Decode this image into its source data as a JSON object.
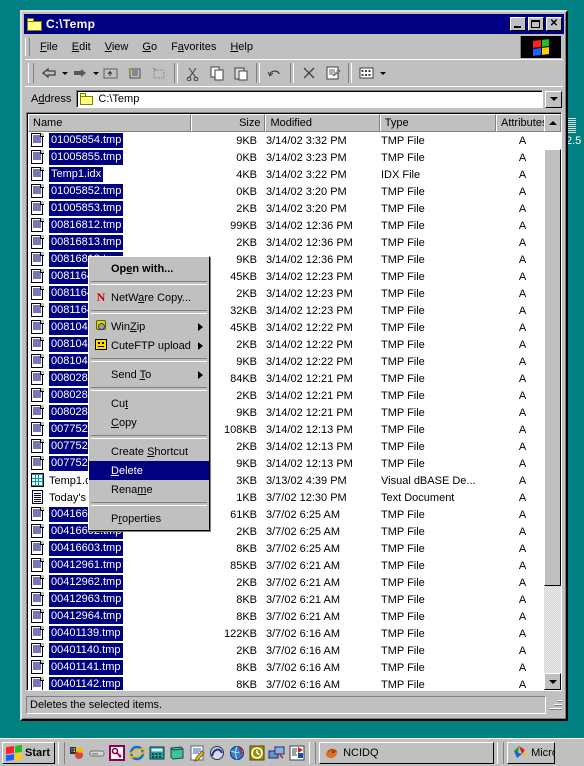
{
  "window": {
    "title": "C:\\Temp",
    "title_icon": "folder-icon",
    "buttons": {
      "minimize": "_",
      "maximize": "□",
      "close": "✕"
    }
  },
  "menubar": {
    "items": [
      {
        "label": "File",
        "accel": "F"
      },
      {
        "label": "Edit",
        "accel": "E"
      },
      {
        "label": "View",
        "accel": "V"
      },
      {
        "label": "Go",
        "accel": "G"
      },
      {
        "label": "Favorites",
        "accel": "a"
      },
      {
        "label": "Help",
        "accel": "H"
      }
    ]
  },
  "toolbar": {
    "buttons": [
      {
        "name": "back-button",
        "icon": "left-arrow-icon",
        "glyph": "⇦",
        "dropdown": true
      },
      {
        "name": "forward-button",
        "icon": "right-arrow-icon",
        "glyph": "⇨",
        "dropdown": true
      },
      {
        "name": "up-button",
        "icon": "up-folder-icon",
        "glyph": "⬆",
        "dropdown": false
      },
      {
        "name": "map-drive-button",
        "icon": "map-network-drive-icon",
        "glyph": "☷",
        "dropdown": false
      },
      {
        "name": "disconnect-drive-button",
        "icon": "disconnect-network-drive-icon",
        "glyph": "☰",
        "dropdown": false
      },
      {
        "name": "cut-button",
        "icon": "scissors-icon",
        "glyph": "✂",
        "dropdown": false
      },
      {
        "name": "copy-button",
        "icon": "copy-icon",
        "glyph": "⧉",
        "dropdown": false
      },
      {
        "name": "paste-button",
        "icon": "paste-icon",
        "glyph": "Ὄb",
        "dropdown": false
      },
      {
        "name": "undo-button",
        "icon": "undo-arrow-icon",
        "glyph": "↶",
        "dropdown": false
      },
      {
        "name": "delete-button",
        "icon": "x-icon",
        "glyph": "✕",
        "dropdown": false
      },
      {
        "name": "properties-button",
        "icon": "properties-icon",
        "glyph": "☑",
        "dropdown": false
      },
      {
        "name": "views-button",
        "icon": "views-icon",
        "glyph": "▦",
        "dropdown": true
      }
    ]
  },
  "address": {
    "label": "Address",
    "value": "C:\\Temp",
    "icon": "folder-icon",
    "dropdown_icon": "chevron-down-icon"
  },
  "columns": [
    {
      "key": "name",
      "label": "Name",
      "align": "left"
    },
    {
      "key": "size",
      "label": "Size",
      "align": "right"
    },
    {
      "key": "modified",
      "label": "Modified",
      "align": "left"
    },
    {
      "key": "type",
      "label": "Type",
      "align": "left"
    },
    {
      "key": "attributes",
      "label": "Attributes",
      "align": "left"
    }
  ],
  "files": [
    {
      "name": "01005854.tmp",
      "size": "9KB",
      "modified": "3/14/02 3:32 PM",
      "type": "TMP File",
      "attributes": "A",
      "icon": "tmp-file-icon",
      "selected": true,
      "focused": false
    },
    {
      "name": "01005855.tmp",
      "size": "0KB",
      "modified": "3/14/02 3:23 PM",
      "type": "TMP File",
      "attributes": "A",
      "icon": "tmp-file-icon",
      "selected": true,
      "focused": false
    },
    {
      "name": "Temp1.idx",
      "size": "4KB",
      "modified": "3/14/02 3:22 PM",
      "type": "IDX File",
      "attributes": "A",
      "icon": "tmp-file-icon",
      "selected": true,
      "focused": false
    },
    {
      "name": "01005852.tmp",
      "size": "0KB",
      "modified": "3/14/02 3:20 PM",
      "type": "TMP File",
      "attributes": "A",
      "icon": "tmp-file-icon",
      "selected": true,
      "focused": false
    },
    {
      "name": "01005853.tmp",
      "size": "2KB",
      "modified": "3/14/02 3:20 PM",
      "type": "TMP File",
      "attributes": "A",
      "icon": "tmp-file-icon",
      "selected": true,
      "focused": false
    },
    {
      "name": "00816812.tmp",
      "size": "99KB",
      "modified": "3/14/02 12:36 PM",
      "type": "TMP File",
      "attributes": "A",
      "icon": "tmp-file-icon",
      "selected": true,
      "focused": false
    },
    {
      "name": "00816813.tmp",
      "size": "2KB",
      "modified": "3/14/02 12:36 PM",
      "type": "TMP File",
      "attributes": "A",
      "icon": "tmp-file-icon",
      "selected": true,
      "focused": false
    },
    {
      "name": "00816818.tmp",
      "size": "9KB",
      "modified": "3/14/02 12:36 PM",
      "type": "TMP File",
      "attributes": "A",
      "icon": "tmp-file-icon",
      "selected": true,
      "focused": true
    },
    {
      "name": "00811645.tmp",
      "size": "45KB",
      "modified": "3/14/02 12:23 PM",
      "type": "TMP File",
      "attributes": "A",
      "icon": "tmp-file-icon",
      "selected": true,
      "focused": false
    },
    {
      "name": "00811646.tmp",
      "size": "2KB",
      "modified": "3/14/02 12:23 PM",
      "type": "TMP File",
      "attributes": "A",
      "icon": "tmp-file-icon",
      "selected": true,
      "focused": false
    },
    {
      "name": "00811647.tmp",
      "size": "32KB",
      "modified": "3/14/02 12:23 PM",
      "type": "TMP File",
      "attributes": "A",
      "icon": "tmp-file-icon",
      "selected": true,
      "focused": false
    },
    {
      "name": "00810452.tmp",
      "size": "45KB",
      "modified": "3/14/02 12:22 PM",
      "type": "TMP File",
      "attributes": "A",
      "icon": "tmp-file-icon",
      "selected": true,
      "focused": false
    },
    {
      "name": "00810453.tmp",
      "size": "2KB",
      "modified": "3/14/02 12:22 PM",
      "type": "TMP File",
      "attributes": "A",
      "icon": "tmp-file-icon",
      "selected": true,
      "focused": false
    },
    {
      "name": "00810454.tmp",
      "size": "9KB",
      "modified": "3/14/02 12:22 PM",
      "type": "TMP File",
      "attributes": "A",
      "icon": "tmp-file-icon",
      "selected": true,
      "focused": false
    },
    {
      "name": "00802853.tmp",
      "size": "84KB",
      "modified": "3/14/02 12:21 PM",
      "type": "TMP File",
      "attributes": "A",
      "icon": "tmp-file-icon",
      "selected": true,
      "focused": false
    },
    {
      "name": "00802854.tmp",
      "size": "2KB",
      "modified": "3/14/02 12:21 PM",
      "type": "TMP File",
      "attributes": "A",
      "icon": "tmp-file-icon",
      "selected": true,
      "focused": false
    },
    {
      "name": "00802855.tmp",
      "size": "9KB",
      "modified": "3/14/02 12:21 PM",
      "type": "TMP File",
      "attributes": "A",
      "icon": "tmp-file-icon",
      "selected": true,
      "focused": false
    },
    {
      "name": "00775260.tmp",
      "size": "108KB",
      "modified": "3/14/02 12:13 PM",
      "type": "TMP File",
      "attributes": "A",
      "icon": "tmp-file-icon",
      "selected": true,
      "focused": false
    },
    {
      "name": "00775261.tmp",
      "size": "2KB",
      "modified": "3/14/02 12:13 PM",
      "type": "TMP File",
      "attributes": "A",
      "icon": "tmp-file-icon",
      "selected": true,
      "focused": false
    },
    {
      "name": "00775262.tmp",
      "size": "9KB",
      "modified": "3/14/02 12:13 PM",
      "type": "TMP File",
      "attributes": "A",
      "icon": "tmp-file-icon",
      "selected": true,
      "focused": false
    },
    {
      "name": "Temp1.dbf",
      "size": "3KB",
      "modified": "3/13/02 4:39 PM",
      "type": "Visual dBASE De...",
      "attributes": "A",
      "icon": "dbase-file-icon",
      "selected": false,
      "focused": false
    },
    {
      "name": "Today's N",
      "size": "1KB",
      "modified": "3/7/02 12:30 PM",
      "type": "Text Document",
      "attributes": "A",
      "icon": "text-file-icon",
      "selected": false,
      "focused": false
    },
    {
      "name": "00416601.tmp",
      "size": "61KB",
      "modified": "3/7/02 6:25 AM",
      "type": "TMP File",
      "attributes": "A",
      "icon": "tmp-file-icon",
      "selected": true,
      "focused": false
    },
    {
      "name": "00416602.tmp",
      "size": "2KB",
      "modified": "3/7/02 6:25 AM",
      "type": "TMP File",
      "attributes": "A",
      "icon": "tmp-file-icon",
      "selected": true,
      "focused": false
    },
    {
      "name": "00416603.tmp",
      "size": "8KB",
      "modified": "3/7/02 6:25 AM",
      "type": "TMP File",
      "attributes": "A",
      "icon": "tmp-file-icon",
      "selected": true,
      "focused": false
    },
    {
      "name": "00412961.tmp",
      "size": "85KB",
      "modified": "3/7/02 6:21 AM",
      "type": "TMP File",
      "attributes": "A",
      "icon": "tmp-file-icon",
      "selected": true,
      "focused": false
    },
    {
      "name": "00412962.tmp",
      "size": "2KB",
      "modified": "3/7/02 6:21 AM",
      "type": "TMP File",
      "attributes": "A",
      "icon": "tmp-file-icon",
      "selected": true,
      "focused": false
    },
    {
      "name": "00412963.tmp",
      "size": "8KB",
      "modified": "3/7/02 6:21 AM",
      "type": "TMP File",
      "attributes": "A",
      "icon": "tmp-file-icon",
      "selected": true,
      "focused": false
    },
    {
      "name": "00412964.tmp",
      "size": "8KB",
      "modified": "3/7/02 6:21 AM",
      "type": "TMP File",
      "attributes": "A",
      "icon": "tmp-file-icon",
      "selected": true,
      "focused": false
    },
    {
      "name": "00401139.tmp",
      "size": "122KB",
      "modified": "3/7/02 6:16 AM",
      "type": "TMP File",
      "attributes": "A",
      "icon": "tmp-file-icon",
      "selected": true,
      "focused": false
    },
    {
      "name": "00401140.tmp",
      "size": "2KB",
      "modified": "3/7/02 6:16 AM",
      "type": "TMP File",
      "attributes": "A",
      "icon": "tmp-file-icon",
      "selected": true,
      "focused": false
    },
    {
      "name": "00401141.tmp",
      "size": "8KB",
      "modified": "3/7/02 6:16 AM",
      "type": "TMP File",
      "attributes": "A",
      "icon": "tmp-file-icon",
      "selected": true,
      "focused": false
    },
    {
      "name": "00401142.tmp",
      "size": "8KB",
      "modified": "3/7/02 6:16 AM",
      "type": "TMP File",
      "attributes": "A",
      "icon": "tmp-file-icon",
      "selected": true,
      "focused": false
    }
  ],
  "context_menu": {
    "items": [
      {
        "label": "Open with...",
        "bold": true,
        "icon": null,
        "submenu": false,
        "selected": false,
        "sep_after": true
      },
      {
        "label": "NetWare Copy...",
        "bold": false,
        "icon": "netware-icon",
        "submenu": false,
        "selected": false,
        "sep_after": true
      },
      {
        "label": "WinZip",
        "bold": false,
        "icon": "winzip-icon",
        "submenu": true,
        "selected": false,
        "sep_after": false
      },
      {
        "label": "CuteFTP upload",
        "bold": false,
        "icon": "cuteftp-icon",
        "submenu": true,
        "selected": false,
        "sep_after": true
      },
      {
        "label": "Send To",
        "bold": false,
        "icon": null,
        "submenu": true,
        "selected": false,
        "sep_after": true
      },
      {
        "label": "Cut",
        "bold": false,
        "icon": null,
        "submenu": false,
        "selected": false,
        "sep_after": false
      },
      {
        "label": "Copy",
        "bold": false,
        "icon": null,
        "submenu": false,
        "selected": false,
        "sep_after": true
      },
      {
        "label": "Create Shortcut",
        "bold": false,
        "icon": null,
        "submenu": false,
        "selected": false,
        "sep_after": false
      },
      {
        "label": "Delete",
        "bold": false,
        "icon": null,
        "submenu": false,
        "selected": true,
        "sep_after": false
      },
      {
        "label": "Rename",
        "bold": false,
        "icon": null,
        "submenu": false,
        "selected": false,
        "sep_after": true
      },
      {
        "label": "Properties",
        "bold": false,
        "icon": null,
        "submenu": false,
        "selected": false,
        "sep_after": false
      }
    ]
  },
  "statusbar": {
    "text": "Deletes the selected items."
  },
  "taskbar": {
    "start_label": "Start",
    "quick_launch": [
      {
        "name": "quicklaunch-paint-icon",
        "icon": "paint-icon"
      },
      {
        "name": "quicklaunch-drive-icon",
        "icon": "floppy-drive-icon"
      },
      {
        "name": "quicklaunch-key-icon",
        "icon": "key-icon"
      },
      {
        "name": "quicklaunch-ie-icon",
        "icon": "internet-explorer-icon"
      },
      {
        "name": "quicklaunch-calculator-icon",
        "icon": "calculator-icon"
      },
      {
        "name": "quicklaunch-notes-icon",
        "icon": "notes-icon"
      },
      {
        "name": "quicklaunch-wordpad-icon",
        "icon": "wordpad-icon"
      },
      {
        "name": "quicklaunch-netscape-icon",
        "icon": "netscape-icon"
      },
      {
        "name": "quicklaunch-globe-icon",
        "icon": "globe-icon"
      },
      {
        "name": "quicklaunch-clock-icon",
        "icon": "clock-icon"
      },
      {
        "name": "quicklaunch-network-icon",
        "icon": "network-neighborhood-icon"
      },
      {
        "name": "quicklaunch-powerpoint-icon",
        "icon": "powerpoint-icon"
      }
    ],
    "tasks": [
      {
        "label": "NCIDQ",
        "icon": "firefox-icon",
        "active": false
      },
      {
        "label": "Micros",
        "icon": "microsoft-icon",
        "active": false
      }
    ]
  },
  "desktop": {
    "artifact_text": "2.5"
  }
}
